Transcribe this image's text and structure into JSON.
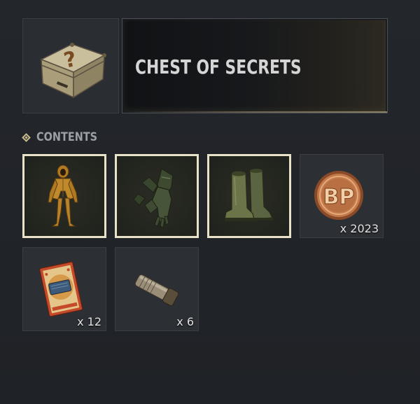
{
  "header": {
    "title": "CHEST OF SECRETS",
    "icon": "mystery-chest-icon"
  },
  "contents": {
    "label": "CONTENTS",
    "items": [
      {
        "name": "Hazmat Suit",
        "icon": "hazmat-suit-icon",
        "equipped": true,
        "quantity": ""
      },
      {
        "name": "Rubber Gloves",
        "icon": "gloves-icon",
        "equipped": true,
        "quantity": ""
      },
      {
        "name": "Rubber Boots",
        "icon": "boots-icon",
        "equipped": true,
        "quantity": ""
      },
      {
        "name": "BP Coin",
        "icon": "bp-coin-icon",
        "equipped": false,
        "quantity": "x 2023"
      },
      {
        "name": "Ticket",
        "icon": "ticket-icon",
        "equipped": false,
        "quantity": "x 12"
      },
      {
        "name": "Capsule",
        "icon": "capsule-icon",
        "equipped": false,
        "quantity": "x 6"
      }
    ]
  },
  "colors": {
    "accent": "#c9b98d",
    "equipped_border": "#e8e3c8",
    "coin": "#b86f42"
  }
}
